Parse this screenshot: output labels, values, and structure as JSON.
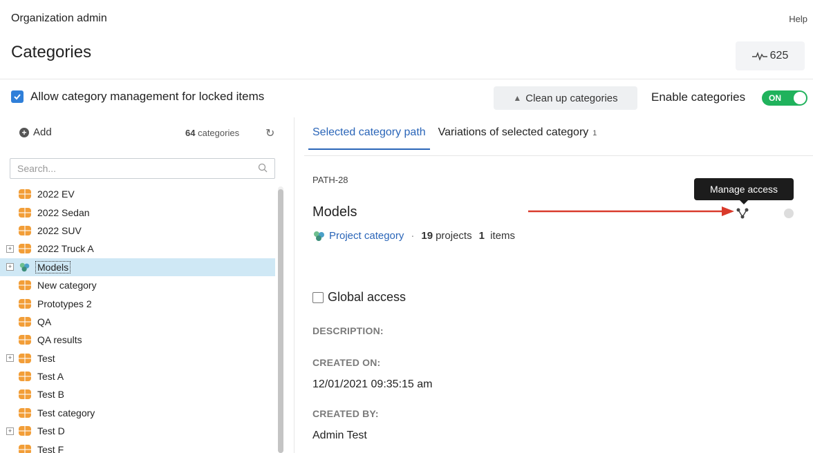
{
  "header": {
    "section_title": "Organization admin",
    "help_label": "Help",
    "page_title": "Categories",
    "activity_count": "625"
  },
  "toolbar": {
    "allow_locked_label": "Allow category management for locked items",
    "allow_locked_checked": true,
    "cleanup_label": "Clean up categories",
    "enable_label": "Enable categories",
    "toggle_text": "ON"
  },
  "sidebar": {
    "add_label": "Add",
    "count_number": "64",
    "count_suffix": "categories",
    "search_placeholder": "Search...",
    "items": [
      {
        "label": "2022 EV",
        "icon": "category-icon",
        "expandable": false
      },
      {
        "label": "2022 Sedan",
        "icon": "category-icon",
        "expandable": false
      },
      {
        "label": "2022 SUV",
        "icon": "category-icon",
        "expandable": false
      },
      {
        "label": "2022 Truck A",
        "icon": "category-icon",
        "expandable": true
      },
      {
        "label": "Models",
        "icon": "project-category-icon",
        "expandable": true,
        "selected": true
      },
      {
        "label": "New category",
        "icon": "category-icon",
        "expandable": false
      },
      {
        "label": "Prototypes 2",
        "icon": "category-icon",
        "expandable": false
      },
      {
        "label": "QA",
        "icon": "category-icon",
        "expandable": false
      },
      {
        "label": "QA results",
        "icon": "category-icon",
        "expandable": false
      },
      {
        "label": "Test",
        "icon": "category-icon",
        "expandable": true
      },
      {
        "label": "Test A",
        "icon": "category-icon",
        "expandable": false
      },
      {
        "label": "Test B",
        "icon": "category-icon",
        "expandable": false
      },
      {
        "label": "Test category",
        "icon": "category-icon",
        "expandable": false
      },
      {
        "label": "Test D",
        "icon": "category-icon",
        "expandable": true
      },
      {
        "label": "Test F",
        "icon": "category-icon",
        "expandable": false
      }
    ]
  },
  "main": {
    "tabs": [
      {
        "label": "Selected category path",
        "active": true
      },
      {
        "label": "Variations of selected category",
        "badge": "1"
      }
    ],
    "path_id": "PATH-28",
    "title": "Models",
    "type_label": "Project category",
    "projects_count": "19",
    "projects_label": "projects",
    "items_count": "1",
    "items_label": "items",
    "tooltip": "Manage access",
    "global_access_label": "Global access",
    "description_label": "DESCRIPTION:",
    "created_on_label": "CREATED ON:",
    "created_on_value": "12/01/2021 09:35:15 am",
    "created_by_label": "CREATED BY:",
    "created_by_value": "Admin Test"
  },
  "colors": {
    "accent": "#2a65b8",
    "toggle_on": "#20b25c",
    "category_icon": "#f29e38",
    "selected_row": "#cfe8f5",
    "annotation_arrow": "#d93a2b"
  }
}
